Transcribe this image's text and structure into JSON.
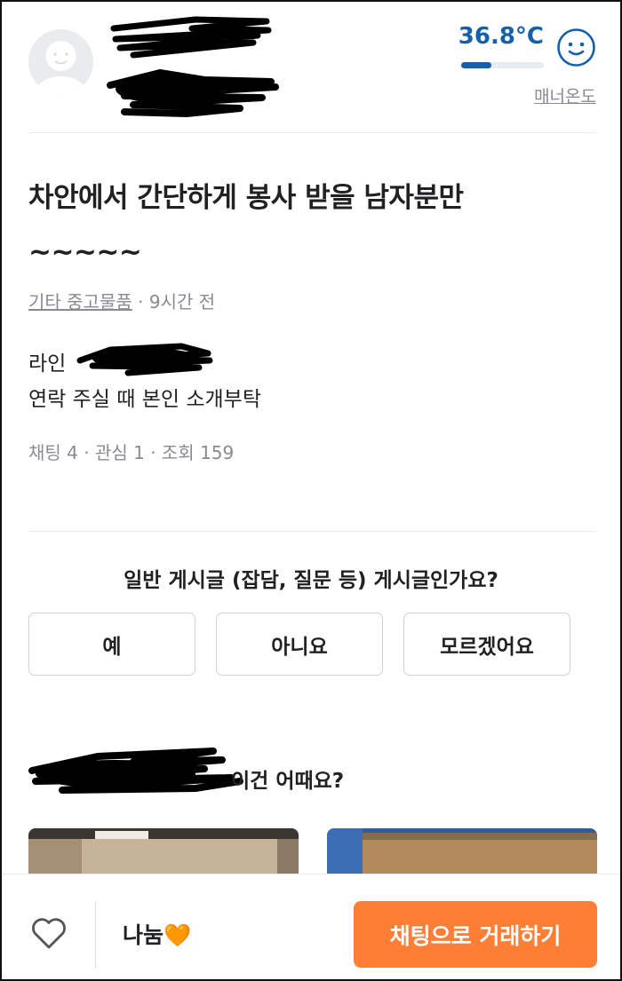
{
  "seller": {
    "temperature": "36.8°C",
    "temperature_fraction": 0.368,
    "manner_label": "매너온도"
  },
  "article": {
    "title": "차안에서 간단하게 봉사 받을 남자분만 ~~~~~",
    "category": "기타 중고물품",
    "time": " · 9시간 전",
    "body_line1": "라인",
    "body_line2": "연락 주실 때 본인 소개부탁",
    "stats": "채팅 4 · 관심 1 · 조회 159"
  },
  "survey": {
    "question": "일반 게시글 (잡담, 질문 등) 게시글인가요?",
    "options": [
      "예",
      "아니요",
      "모르겠어요"
    ]
  },
  "recommend": {
    "title_visible": "이건 어때요?"
  },
  "bottom": {
    "price": "나눔",
    "price_emoji": "🧡",
    "chat_button": "채팅으로 거래하기"
  },
  "colors": {
    "accent_orange": "#ff7e36",
    "temperature_blue": "#1561a9"
  },
  "icons": [
    "avatar-face-icon",
    "smiley-face-icon",
    "heart-outline-icon"
  ]
}
